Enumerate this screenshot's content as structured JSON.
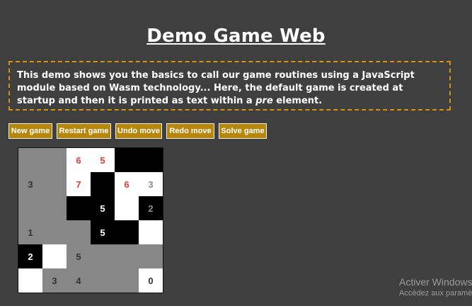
{
  "page": {
    "title": "Demo Game Web",
    "description_before": "This demo shows you the basics to call our game routines using a JavaScript module based on Wasm technology... Here, the default game is created at startup and then it is printed as text within a ",
    "description_em": "pre",
    "description_after": " element."
  },
  "toolbar": {
    "new_game": "New game",
    "restart_game": "Restart game",
    "undo_move": "Undo move",
    "redo_move": "Redo move",
    "solve_game": "Solve game"
  },
  "colors": {
    "background": "#3f3f3f",
    "accent": "#b8860b",
    "border_dashed": "#d4930c",
    "red_number": "#e53935"
  },
  "board": {
    "rows": 6,
    "cols": 6,
    "cells": [
      [
        {
          "c": "grey",
          "t": ""
        },
        {
          "c": "grey",
          "t": ""
        },
        {
          "c": "white",
          "t": "6",
          "tc": "red"
        },
        {
          "c": "white",
          "t": "5",
          "tc": "red"
        },
        {
          "c": "black",
          "t": ""
        },
        {
          "c": "black",
          "t": ""
        }
      ],
      [
        {
          "c": "grey",
          "t": "3",
          "tc": "dark"
        },
        {
          "c": "grey",
          "t": ""
        },
        {
          "c": "white",
          "t": "7",
          "tc": "red"
        },
        {
          "c": "black",
          "t": ""
        },
        {
          "c": "white",
          "t": "6",
          "tc": "red"
        },
        {
          "c": "white",
          "t": "3",
          "tc": "dim"
        }
      ],
      [
        {
          "c": "grey",
          "t": ""
        },
        {
          "c": "grey",
          "t": ""
        },
        {
          "c": "black",
          "t": ""
        },
        {
          "c": "black",
          "t": "5",
          "tc": "light"
        },
        {
          "c": "white",
          "t": ""
        },
        {
          "c": "black",
          "t": "2",
          "tc": "dim"
        }
      ],
      [
        {
          "c": "grey",
          "t": "1",
          "tc": "dark"
        },
        {
          "c": "grey",
          "t": ""
        },
        {
          "c": "grey",
          "t": ""
        },
        {
          "c": "black",
          "t": "5",
          "tc": "light"
        },
        {
          "c": "black",
          "t": ""
        },
        {
          "c": "white",
          "t": ""
        }
      ],
      [
        {
          "c": "black",
          "t": "2",
          "tc": "light"
        },
        {
          "c": "white",
          "t": ""
        },
        {
          "c": "grey",
          "t": "5",
          "tc": "dark"
        },
        {
          "c": "grey",
          "t": ""
        },
        {
          "c": "grey",
          "t": ""
        },
        {
          "c": "grey",
          "t": ""
        }
      ],
      [
        {
          "c": "white",
          "t": ""
        },
        {
          "c": "grey",
          "t": "3",
          "tc": "dark"
        },
        {
          "c": "grey",
          "t": "4",
          "tc": "dark"
        },
        {
          "c": "grey",
          "t": ""
        },
        {
          "c": "grey",
          "t": ""
        },
        {
          "c": "white",
          "t": "0",
          "tc": "dark"
        }
      ]
    ]
  },
  "watermark": {
    "line1": "Activer Windows",
    "line2": "Accédez aux paramètres"
  }
}
